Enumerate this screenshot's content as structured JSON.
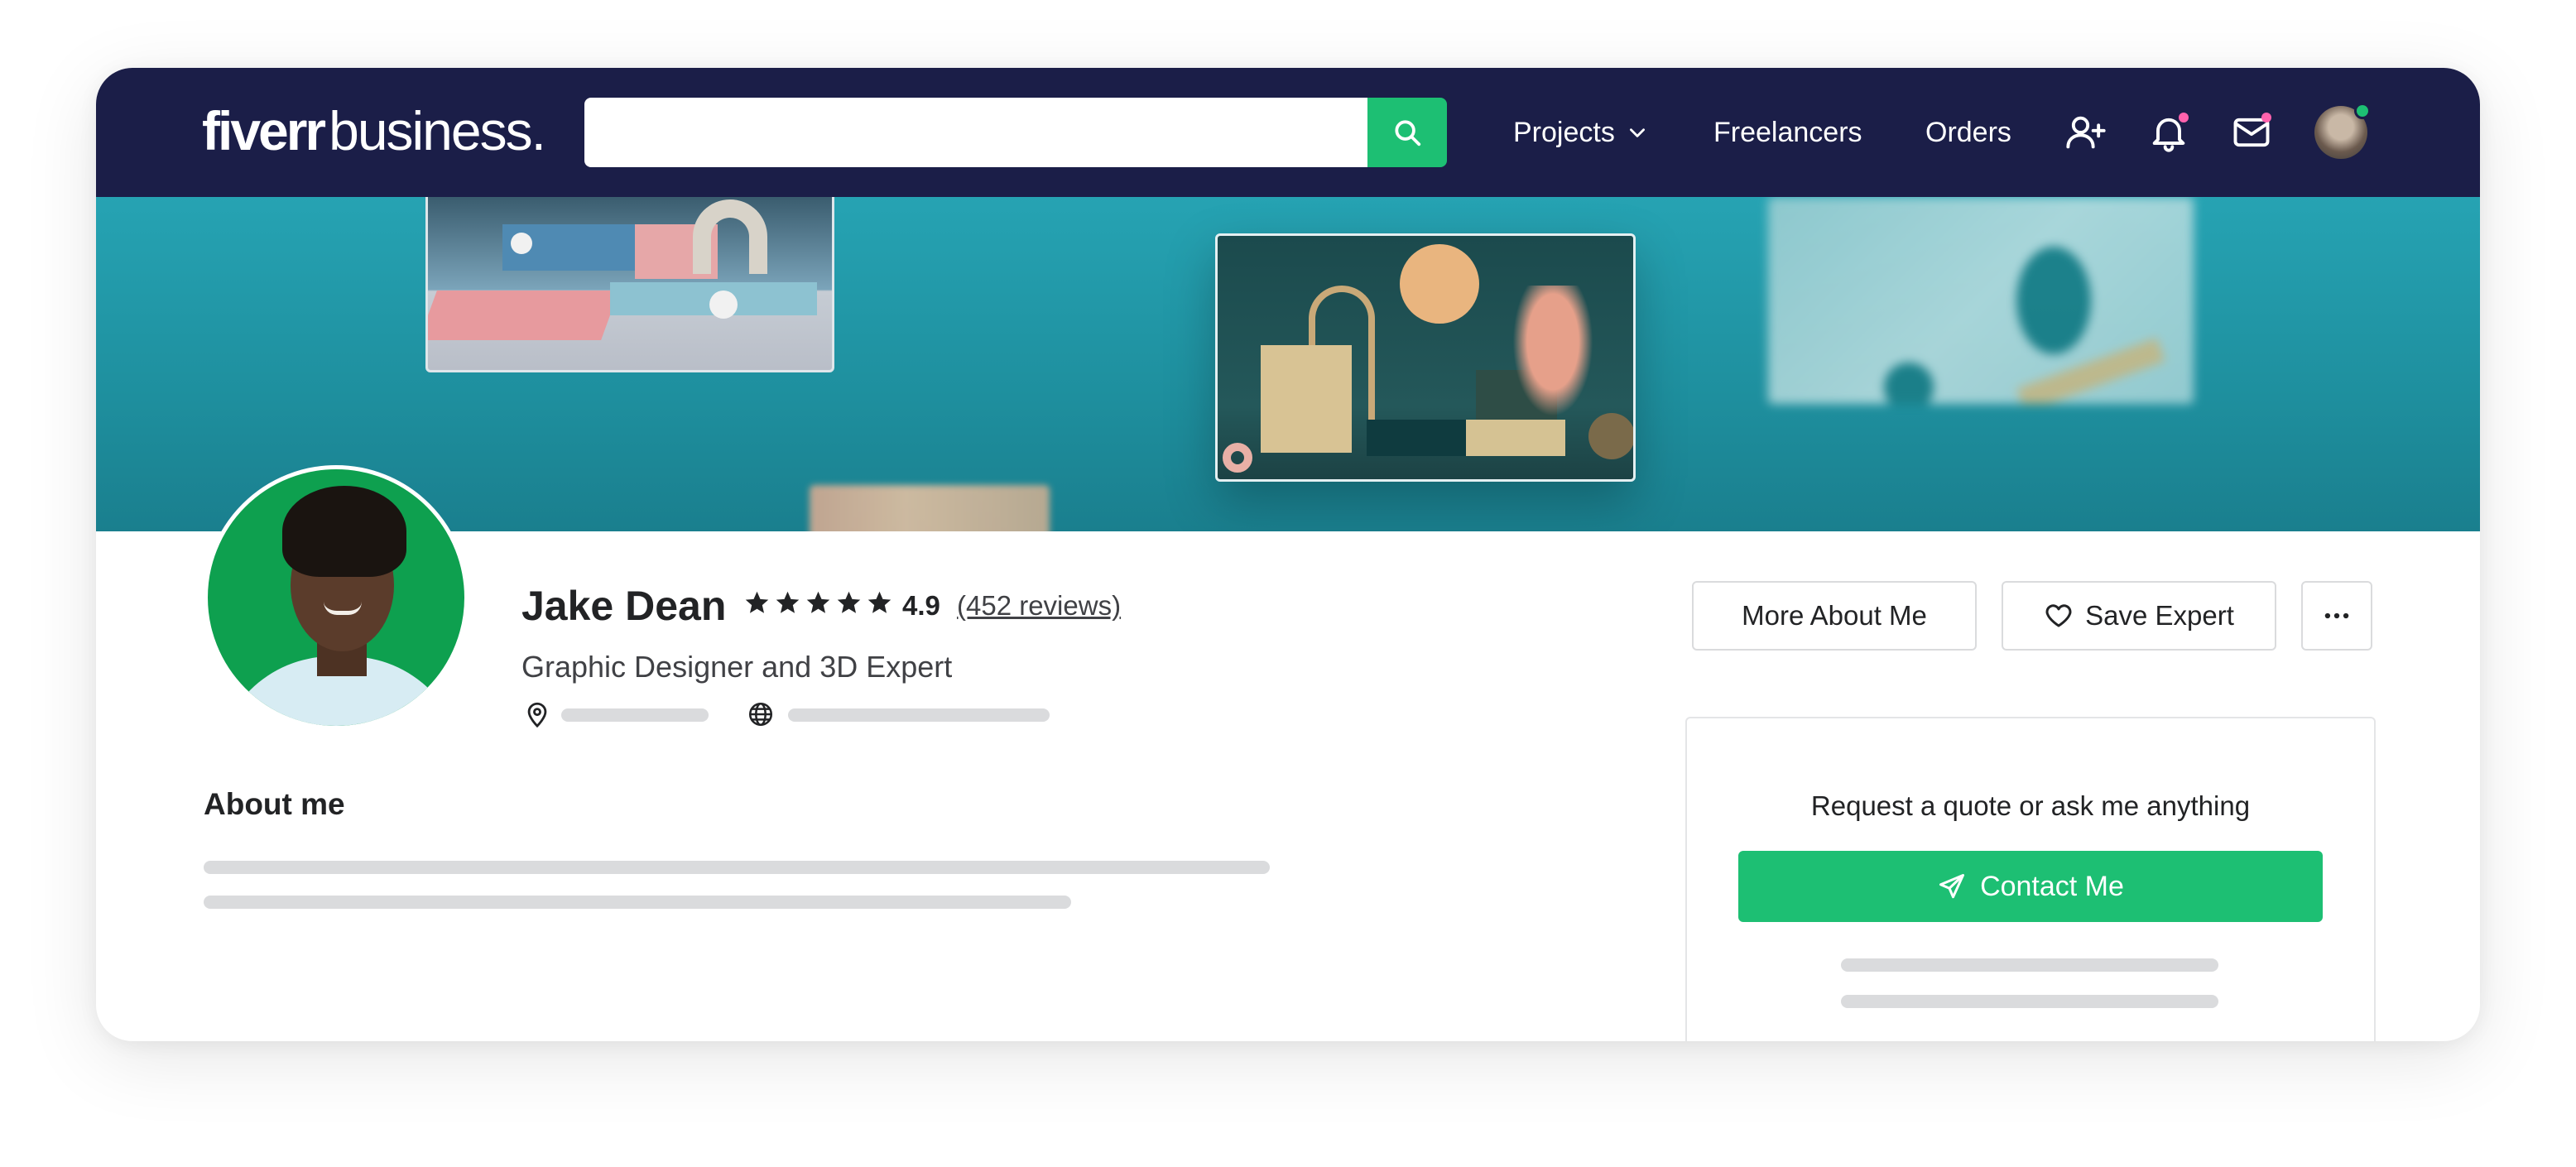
{
  "navbar": {
    "logo_brand": "fiverr",
    "logo_suffix": "business.",
    "search": {
      "value": "",
      "placeholder": ""
    },
    "links": {
      "projects": "Projects",
      "freelancers": "Freelancers",
      "orders": "Orders"
    },
    "icons": [
      "add-user-icon",
      "bell-icon",
      "mail-icon"
    ]
  },
  "profile": {
    "name": "Jake Dean",
    "rating": "4.9",
    "stars": 5,
    "reviews": "(452 reviews)",
    "headline": "Graphic Designer and 3D Expert"
  },
  "actions": {
    "more_about": "More About Me",
    "save_expert": "Save Expert"
  },
  "about": {
    "title": "About me"
  },
  "contact": {
    "title": "Request a quote or ask me anything",
    "button": "Contact Me"
  },
  "colors": {
    "nav_bg": "#1b1e48",
    "accent": "#1dbf73",
    "banner": "#1e8f9e",
    "notification": "#ff62ad",
    "skeleton": "#dadbdd"
  }
}
